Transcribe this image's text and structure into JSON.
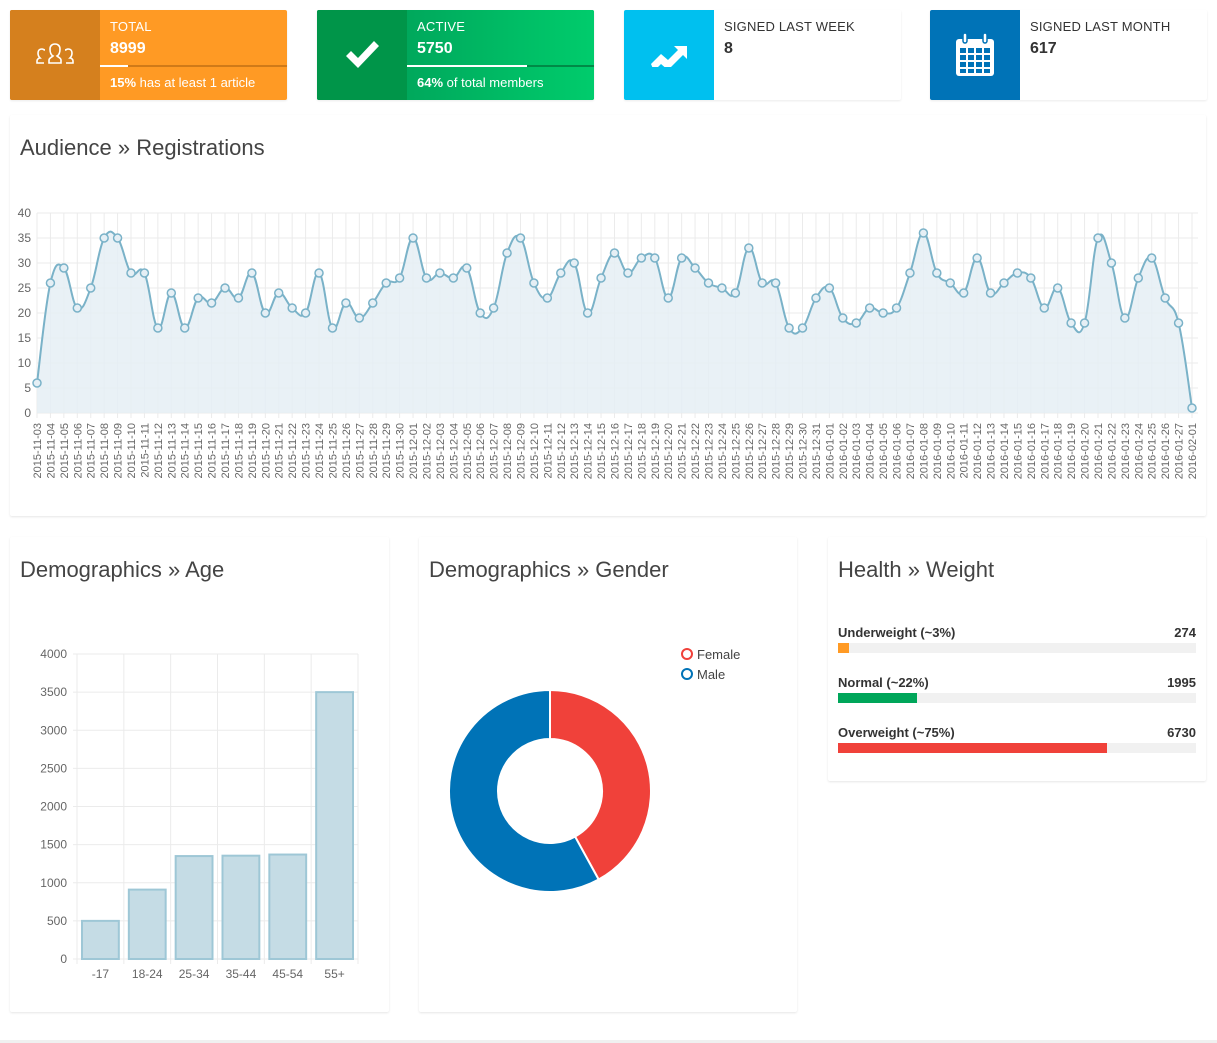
{
  "stats": {
    "total": {
      "label": "TOTAL",
      "value": "8999",
      "progress_pct": 15,
      "desc_bold": "15%",
      "desc_rest": " has at least 1 article",
      "icon": "users-icon",
      "color": "#ff9a24"
    },
    "active": {
      "label": "ACTIVE",
      "value": "5750",
      "progress_pct": 64,
      "desc_bold": "64%",
      "desc_rest": " of total members",
      "icon": "checkmark-icon",
      "color": "#00a65a"
    },
    "week": {
      "label": "SIGNED LAST WEEK",
      "value": "8",
      "icon": "trending-up-icon",
      "color": "#00c0ef"
    },
    "month": {
      "label": "SIGNED LAST MONTH",
      "value": "617",
      "icon": "calendar-icon",
      "color": "#0073b7"
    }
  },
  "panels": {
    "registrations_title": "Audience » Registrations",
    "age_title": "Demographics » Age",
    "gender_title": "Demographics » Gender",
    "weight_title": "Health » Weight"
  },
  "weight": [
    {
      "label": "Underweight (~3%)",
      "value": "274",
      "pct": 3,
      "color": "#ff9a24"
    },
    {
      "label": "Normal (~22%)",
      "value": "1995",
      "pct": 22,
      "color": "#00a65a"
    },
    {
      "label": "Overweight (~75%)",
      "value": "6730",
      "pct": 75,
      "color": "#f0413a"
    }
  ],
  "chart_data": [
    {
      "type": "area",
      "title": "Audience » Registrations",
      "xlabel": "",
      "ylabel": "",
      "ylim": [
        0,
        40
      ],
      "yticks": [
        0,
        5,
        10,
        15,
        20,
        25,
        30,
        35,
        40
      ],
      "grid": true,
      "line_color": "#7ab2c8",
      "fill_color": "#e5eff5",
      "x": [
        "2015-11-03",
        "2015-11-04",
        "2015-11-05",
        "2015-11-06",
        "2015-11-07",
        "2015-11-08",
        "2015-11-09",
        "2015-11-10",
        "2015-11-11",
        "2015-11-12",
        "2015-11-13",
        "2015-11-14",
        "2015-11-15",
        "2015-11-16",
        "2015-11-17",
        "2015-11-18",
        "2015-11-19",
        "2015-11-20",
        "2015-11-21",
        "2015-11-22",
        "2015-11-23",
        "2015-11-24",
        "2015-11-25",
        "2015-11-26",
        "2015-11-27",
        "2015-11-28",
        "2015-11-29",
        "2015-11-30",
        "2015-12-01",
        "2015-12-02",
        "2015-12-03",
        "2015-12-04",
        "2015-12-05",
        "2015-12-06",
        "2015-12-07",
        "2015-12-08",
        "2015-12-09",
        "2015-12-10",
        "2015-12-11",
        "2015-12-12",
        "2015-12-13",
        "2015-12-14",
        "2015-12-15",
        "2015-12-16",
        "2015-12-17",
        "2015-12-18",
        "2015-12-19",
        "2015-12-20",
        "2015-12-21",
        "2015-12-22",
        "2015-12-23",
        "2015-12-24",
        "2015-12-25",
        "2015-12-26",
        "2015-12-27",
        "2015-12-28",
        "2015-12-29",
        "2015-12-30",
        "2015-12-31",
        "2016-01-01",
        "2016-01-02",
        "2016-01-03",
        "2016-01-04",
        "2016-01-05",
        "2016-01-06",
        "2016-01-07",
        "2016-01-08",
        "2016-01-09",
        "2016-01-10",
        "2016-01-11",
        "2016-01-12",
        "2016-01-13",
        "2016-01-14",
        "2016-01-15",
        "2016-01-16",
        "2016-01-17",
        "2016-01-18",
        "2016-01-19",
        "2016-01-20",
        "2016-01-21",
        "2016-01-22",
        "2016-01-23",
        "2016-01-24",
        "2016-01-25",
        "2016-01-26",
        "2016-01-27",
        "2016-02-01"
      ],
      "values": [
        6,
        26,
        29,
        21,
        25,
        35,
        35,
        28,
        28,
        17,
        24,
        17,
        23,
        22,
        25,
        23,
        28,
        20,
        24,
        21,
        20,
        28,
        17,
        22,
        19,
        22,
        26,
        27,
        35,
        27,
        28,
        27,
        29,
        20,
        21,
        32,
        35,
        26,
        23,
        28,
        30,
        20,
        27,
        32,
        28,
        31,
        31,
        23,
        31,
        29,
        26,
        25,
        24,
        33,
        26,
        26,
        17,
        17,
        23,
        25,
        19,
        18,
        21,
        20,
        21,
        28,
        36,
        28,
        26,
        24,
        31,
        24,
        26,
        28,
        27,
        21,
        25,
        18,
        18,
        35,
        30,
        19,
        27,
        31,
        23,
        18,
        1
      ]
    },
    {
      "type": "bar",
      "title": "Demographics » Age",
      "categories": [
        "-17",
        "18-24",
        "25-34",
        "35-44",
        "45-54",
        "55+"
      ],
      "values": [
        500,
        910,
        1350,
        1355,
        1370,
        3500
      ],
      "ylim": [
        0,
        4000
      ],
      "yticks": [
        0,
        500,
        1000,
        1500,
        2000,
        2500,
        3000,
        3500,
        4000
      ],
      "grid": true,
      "bar_color": "#c5dce5",
      "bar_border": "#9ec7d6"
    },
    {
      "type": "pie",
      "variant": "doughnut",
      "title": "Demographics » Gender",
      "labels": [
        "Female",
        "Male"
      ],
      "values": [
        42,
        58
      ],
      "colors": [
        "#f0413a",
        "#0073b7"
      ],
      "legend": "top-right"
    }
  ]
}
